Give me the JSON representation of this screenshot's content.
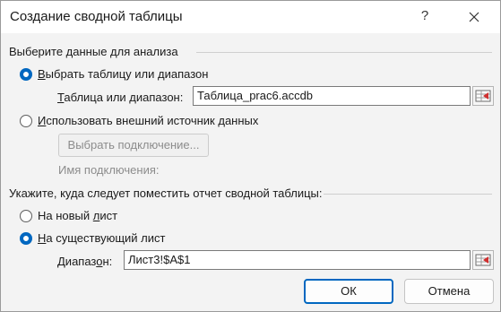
{
  "window": {
    "title": "Создание сводной таблицы",
    "help_glyph": "?",
    "close_glyph": "✕"
  },
  "choose_data": {
    "group_label": "Выберите данные для анализа",
    "option_table": "Выбрать таблицу или диапазон",
    "option_table_selected": true,
    "table_range_label": "Таблица или диапазон:",
    "table_range_value": "Таблица_prac6.accdb",
    "option_external": "Использовать внешний источник данных",
    "option_external_selected": false,
    "choose_connection_button": "Выбрать подключение...",
    "connection_name_label": "Имя подключения:"
  },
  "destination": {
    "group_label": "Укажите, куда следует поместить отчет сводной таблицы:",
    "option_new_sheet": "На новый лист",
    "option_new_sheet_selected": false,
    "option_existing_sheet": "На существующий лист",
    "option_existing_sheet_selected": true,
    "range_label": "Диапазон:",
    "range_value": "Лист3!$A$1"
  },
  "buttons": {
    "ok": "ОК",
    "cancel": "Отмена"
  },
  "icons": {
    "help": "help-icon",
    "close": "close-icon",
    "range_picker": "range-picker-icon"
  },
  "colors": {
    "accent": "#0067c0",
    "background": "#f3f3f3",
    "disabled_text": "#8c8c8c"
  }
}
